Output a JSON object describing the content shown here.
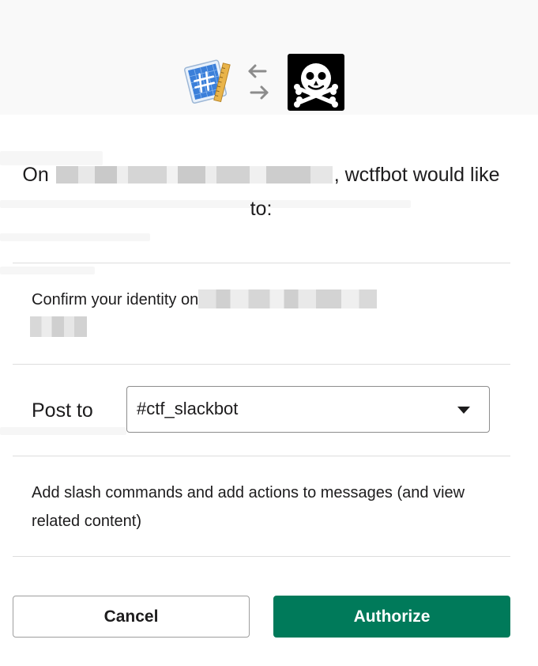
{
  "header": {
    "app_icon": "blueprint-hash-icon",
    "connect_icon": "swap-arrows-icon",
    "bot_avatar": "skull-crossbones-icon"
  },
  "title": {
    "prefix": "On",
    "suffix": ", wctfbot would like to:"
  },
  "permissions": {
    "identity_text": "Confirm your identity on",
    "post_to_label": "Post to",
    "channel_selected": "#ctf_slackbot",
    "slash_commands_text": "Add slash commands and add actions to messages (and view related content)"
  },
  "buttons": {
    "cancel_label": "Cancel",
    "authorize_label": "Authorize"
  },
  "colors": {
    "authorize_bg": "#007a5a",
    "text": "#1d1c1d",
    "divider": "#dddddd"
  }
}
